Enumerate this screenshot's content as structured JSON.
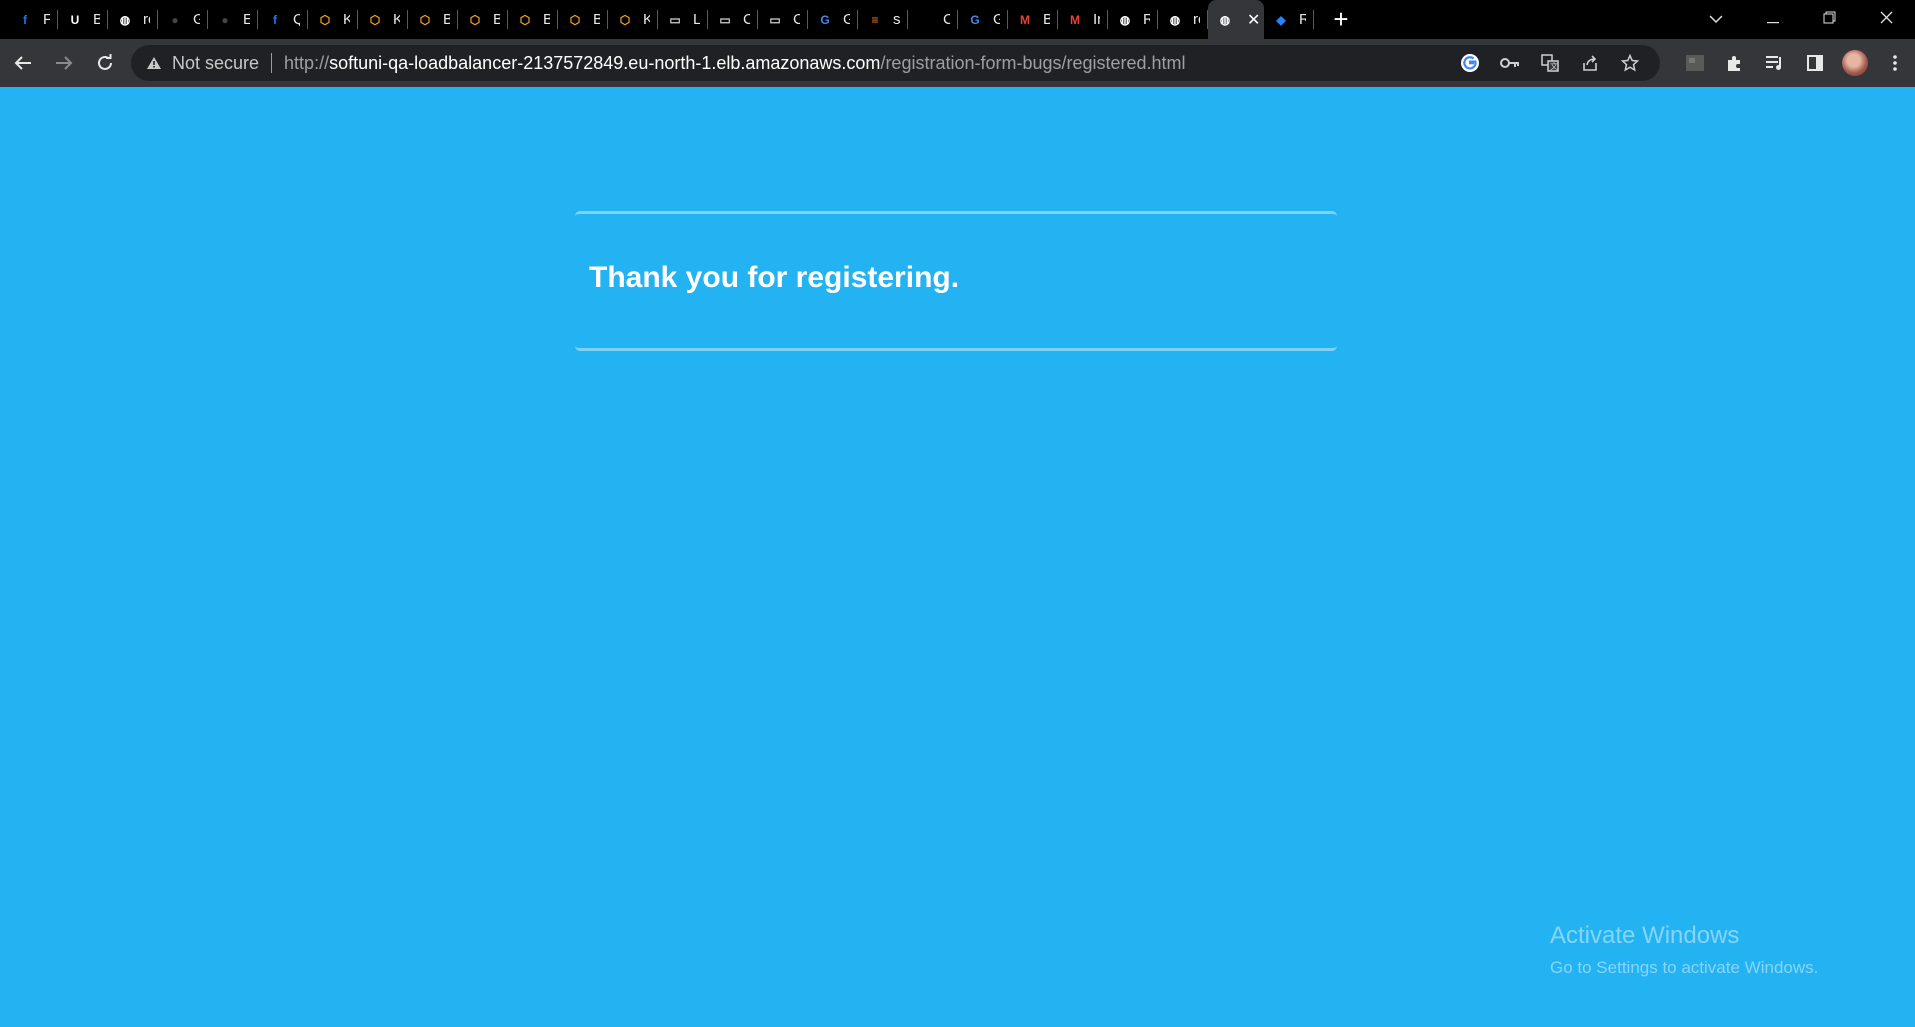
{
  "browser": {
    "tabs": [
      {
        "label": "Fa",
        "icon": "facebook-icon",
        "color": "#1877f2",
        "glyph": "f"
      },
      {
        "label": "Bi",
        "icon": "udemy-icon",
        "color": "#ffffff",
        "glyph": "U"
      },
      {
        "label": "rc",
        "icon": "globe-icon",
        "color": "#ffffff",
        "glyph": "◍"
      },
      {
        "label": "Gi",
        "icon": "github-icon",
        "color": "#444444",
        "glyph": "●"
      },
      {
        "label": "Ev",
        "icon": "github-icon",
        "color": "#444444",
        "glyph": "●"
      },
      {
        "label": "Q",
        "icon": "facebook-icon",
        "color": "#1877f2",
        "glyph": "f"
      },
      {
        "label": "Ky",
        "icon": "softuni-icon",
        "color": "#f5a623",
        "glyph": "⬡"
      },
      {
        "label": "Ky",
        "icon": "softuni-icon",
        "color": "#f5a623",
        "glyph": "⬡"
      },
      {
        "label": "Bi",
        "icon": "softuni-icon",
        "color": "#f5a623",
        "glyph": "⬡"
      },
      {
        "label": "Bi",
        "icon": "softuni-icon",
        "color": "#f5a623",
        "glyph": "⬡"
      },
      {
        "label": "Bi",
        "icon": "softuni-icon",
        "color": "#f5a623",
        "glyph": "⬡"
      },
      {
        "label": "Bi",
        "icon": "softuni-icon",
        "color": "#f5a623",
        "glyph": "⬡"
      },
      {
        "label": "Ki",
        "icon": "softuni-icon",
        "color": "#f5a623",
        "glyph": "⬡"
      },
      {
        "label": "Lc",
        "icon": "window-icon",
        "color": "#cfcfcf",
        "glyph": "▭"
      },
      {
        "label": "C",
        "icon": "window-icon",
        "color": "#cfcfcf",
        "glyph": "▭"
      },
      {
        "label": "C",
        "icon": "window-icon",
        "color": "#cfcfcf",
        "glyph": "▭"
      },
      {
        "label": "G",
        "icon": "translate-icon",
        "color": "#4a86e8",
        "glyph": "G"
      },
      {
        "label": "st",
        "icon": "stackoverflow-icon",
        "color": "#f48024",
        "glyph": "≡"
      },
      {
        "label": "C",
        "icon": "blank-icon",
        "color": "#000000",
        "glyph": ""
      },
      {
        "label": "G",
        "icon": "translate-icon",
        "color": "#4a86e8",
        "glyph": "G"
      },
      {
        "label": "B",
        "icon": "gmail-icon",
        "color": "#ea4335",
        "glyph": "M"
      },
      {
        "label": "In",
        "icon": "gmail-icon",
        "color": "#ea4335",
        "glyph": "M"
      },
      {
        "label": "R",
        "icon": "globe-icon",
        "color": "#ffffff",
        "glyph": "◍"
      },
      {
        "label": "rc",
        "icon": "globe-icon",
        "color": "#ffffff",
        "glyph": "◍"
      },
      {
        "label": "",
        "icon": "globe-icon",
        "color": "#ffffff",
        "glyph": "◍",
        "active": true
      },
      {
        "label": "R",
        "icon": "jira-icon",
        "color": "#2684ff",
        "glyph": "◆"
      }
    ],
    "not_secure_label": "Not secure",
    "url_scheme": "http://",
    "url_host": "softuni-qa-loadbalancer-2137572849.eu-north-1.elb.amazonaws.com",
    "url_path": "/registration-form-bugs/registered.html"
  },
  "page": {
    "message": "Thank you for registering.",
    "background_color": "#23b3f2"
  },
  "watermark": {
    "title": "Activate Windows",
    "subtitle": "Go to Settings to activate Windows."
  }
}
